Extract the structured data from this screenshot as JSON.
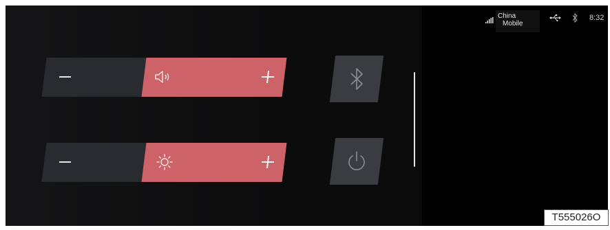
{
  "status_bar": {
    "carrier_line1": "China",
    "carrier_line2": "Mobile",
    "time": "8:32",
    "icons": [
      "signal-icon",
      "usb-icon",
      "bluetooth-icon"
    ]
  },
  "volume_slider": {
    "decrease_icon": "minus-icon",
    "level_icon": "speaker-icon",
    "increase_icon": "plus-icon"
  },
  "brightness_slider": {
    "decrease_icon": "minus-icon",
    "level_icon": "sun-icon",
    "increase_icon": "plus-icon"
  },
  "tiles": {
    "bluetooth": "bluetooth-icon",
    "power": "power-icon"
  },
  "figure_label": "T555026O",
  "colors": {
    "accent": "#cd6268",
    "track": "#2a2b2f",
    "tile": "#3b3c40",
    "background": "#0c0c0d"
  }
}
